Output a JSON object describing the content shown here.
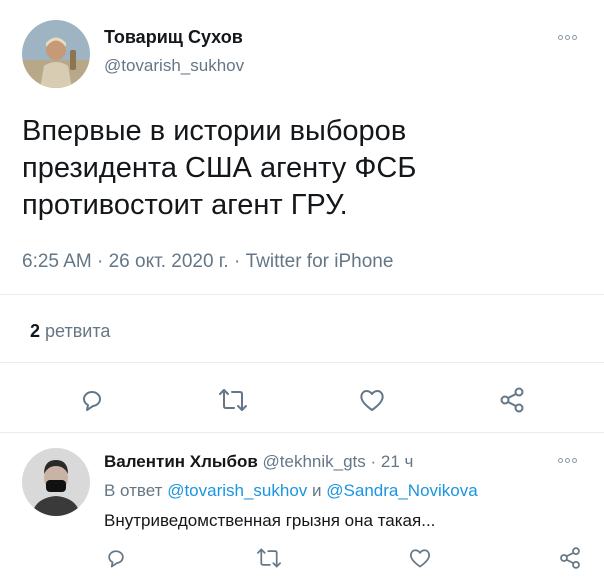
{
  "tweet": {
    "author_name": "Товарищ Сухов",
    "author_handle": "@tovarish_sukhov",
    "text_lines": [
      "Впервые в истории выборов",
      "президента США агенту ФСБ",
      "противостоит агент ГРУ."
    ],
    "meta": "6:25 AM · 26 окт. 2020 г. · Twitter for iPhone",
    "retweet_count": "2",
    "retweet_label": "ретвита"
  },
  "reply": {
    "author_name": "Валентин Хлыбов",
    "author_handle": "@tekhnik_gts",
    "time": "· 21 ч",
    "reply_prefix": "В ответ",
    "mention1": "@tovarish_sukhov",
    "conj": "и",
    "mention2": "@Sandra_Novikova",
    "text": "Внутриведомственная грызня она такая..."
  },
  "icons": {
    "actions": [
      "reply-icon",
      "retweet-icon",
      "like-icon",
      "share-icon"
    ],
    "more": "more-icon"
  },
  "colors": {
    "text": "#14171a",
    "muted": "#657786",
    "link": "#1b95e0",
    "divider": "#e6ecf0"
  }
}
